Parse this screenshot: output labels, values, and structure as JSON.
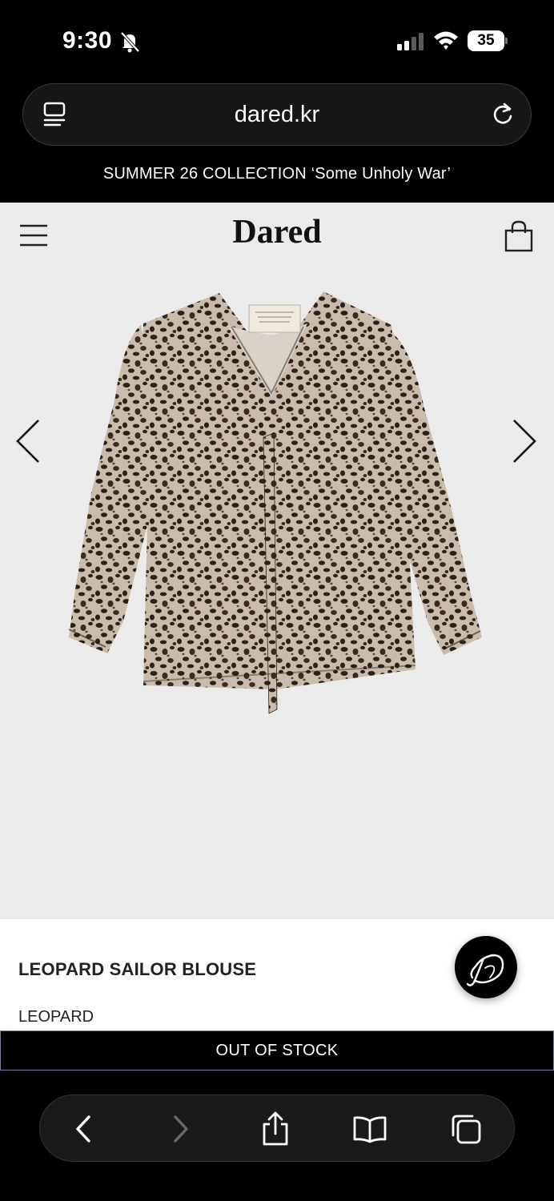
{
  "status_bar": {
    "time": "9:30",
    "battery": "35"
  },
  "browser": {
    "url": "dared.kr"
  },
  "announcement": "SUMMER 26 COLLECTION ‘Some Unholy War’",
  "header": {
    "brand": "Dared"
  },
  "product": {
    "name": "LEOPARD SAILOR BLOUSE",
    "color": "LEOPARD",
    "stock_label": "OUT OF STOCK"
  },
  "icons": {
    "status": [
      "bell-slash-icon",
      "cellular-signal-icon",
      "wifi-icon",
      "battery-icon"
    ],
    "browser": [
      "tabs-list-icon",
      "reload-icon"
    ],
    "page": [
      "hamburger-menu-icon",
      "shopping-bag-icon",
      "chevron-left-icon",
      "chevron-right-icon"
    ],
    "toolbar": [
      "back-icon",
      "forward-icon",
      "share-icon",
      "bookmarks-icon",
      "tabs-icon"
    ]
  },
  "colors": {
    "page_bg": "#ebebeb",
    "text_dark": "#111111",
    "leopard_base": "#c9bcac",
    "leopard_spot": "#2d2018"
  }
}
